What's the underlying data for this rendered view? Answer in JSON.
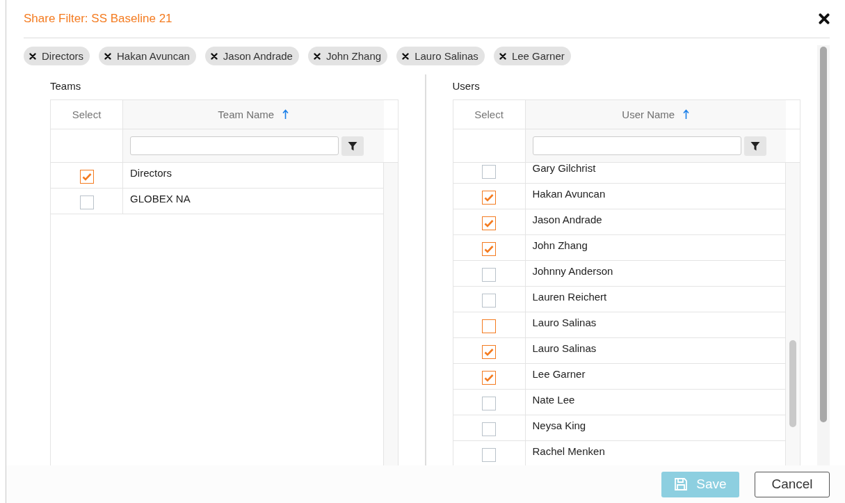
{
  "dialog": {
    "title": "Share Filter: SS Baseline 21"
  },
  "chips": [
    {
      "label": "Directors"
    },
    {
      "label": "Hakan Avuncan"
    },
    {
      "label": "Jason Andrade"
    },
    {
      "label": "John Zhang"
    },
    {
      "label": "Lauro Salinas"
    },
    {
      "label": "Lee Garner"
    }
  ],
  "teams": {
    "heading": "Teams",
    "columns": [
      {
        "label": "Select",
        "sorted": false
      },
      {
        "label": "Team Name",
        "sorted": true
      }
    ],
    "rows": [
      {
        "name": "Directors",
        "checked": true,
        "color": "#f47b20"
      },
      {
        "name": "GLOBEX NA",
        "checked": false,
        "color": "#b9c2ca"
      }
    ]
  },
  "users": {
    "heading": "Users",
    "columns": [
      {
        "label": "Select",
        "sorted": false
      },
      {
        "label": "User Name",
        "sorted": true
      }
    ],
    "rows": [
      {
        "name": "Gary Gilchrist",
        "checked": false,
        "color": "#b9c2ca"
      },
      {
        "name": "Hakan Avuncan",
        "checked": true,
        "color": "#f47b20"
      },
      {
        "name": "Jason Andrade",
        "checked": true,
        "color": "#f47b20"
      },
      {
        "name": "John Zhang",
        "checked": true,
        "color": "#f47b20"
      },
      {
        "name": "Johnny Anderson",
        "checked": false,
        "color": "#b9c2ca"
      },
      {
        "name": "Lauren Reichert",
        "checked": false,
        "color": "#b9c2ca"
      },
      {
        "name": "Lauro Salinas",
        "checked": false,
        "color": "#f47b20"
      },
      {
        "name": "Lauro Salinas",
        "checked": true,
        "color": "#f47b20"
      },
      {
        "name": "Lee Garner",
        "checked": true,
        "color": "#f47b20"
      },
      {
        "name": "Nate Lee",
        "checked": false,
        "color": "#b9c2ca"
      },
      {
        "name": "Neysa King",
        "checked": false,
        "color": "#b9c2ca"
      },
      {
        "name": "Rachel Menken",
        "checked": false,
        "color": "#b9c2ca"
      }
    ]
  },
  "buttons": [
    {
      "kind": "save",
      "label": "Save",
      "disabled": true
    },
    {
      "kind": "cancel",
      "label": "Cancel",
      "disabled": false
    }
  ]
}
